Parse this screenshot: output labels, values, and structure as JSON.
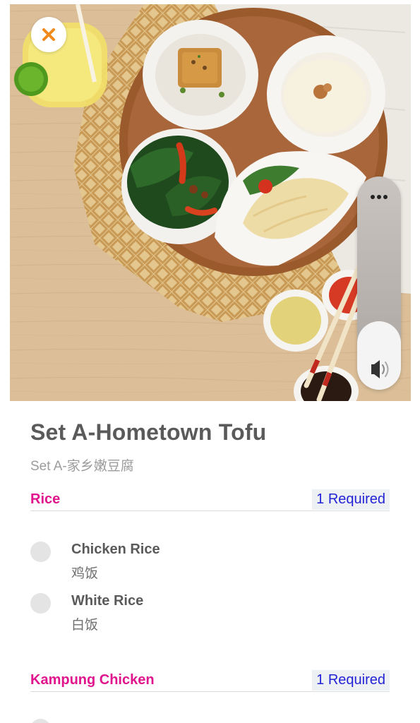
{
  "product": {
    "title": "Set A-Hometown Tofu",
    "subtitle": "Set A-家乡嫩豆腐"
  },
  "controls": {
    "close_icon": "close-icon",
    "more_icon": "more-dots-icon",
    "volume_icon": "speaker-icon",
    "volume_level": 0.32
  },
  "sections": [
    {
      "title": "Rice",
      "badge": "1 Required",
      "options": [
        {
          "name": "Chicken Rice",
          "sub": "鸡饭"
        },
        {
          "name": "White Rice",
          "sub": "白饭"
        }
      ]
    },
    {
      "title": "Kampung Chicken",
      "badge": "1 Required"
    }
  ],
  "colors": {
    "accent_pink": "#e0148c",
    "badge_blue": "#2323d6",
    "close_orange": "#f08a1c"
  }
}
